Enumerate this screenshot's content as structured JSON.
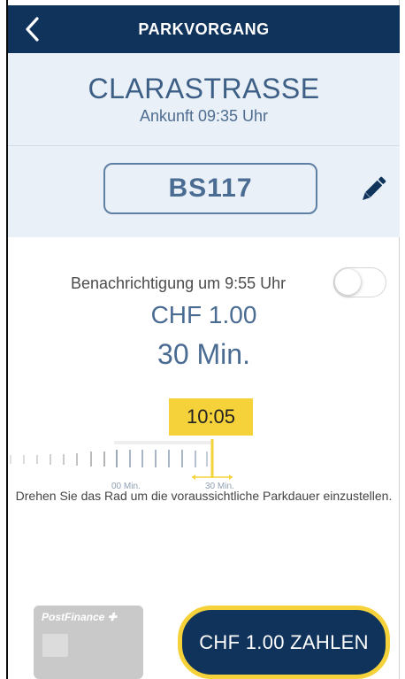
{
  "header": {
    "title": "PARKVORGANG"
  },
  "location": {
    "street": "CLARASTRASSE",
    "arrival": "Ankunft 09:35 Uhr"
  },
  "vehicle": {
    "plate": "BS117"
  },
  "notification": {
    "label": "Benachrichtigung um 9:55 Uhr",
    "enabled": false
  },
  "parking": {
    "price": "CHF 1.00",
    "duration": "30 Min.",
    "end_time": "10:05"
  },
  "wheel": {
    "start_label": "00 Min.",
    "end_label": "30 Min.",
    "hint": "Drehen Sie das Rad um die voraussichtliche Parkdauer einzustellen."
  },
  "payment": {
    "card_brand": "PostFinance",
    "pay_label": "CHF 1.00 ZAHLEN"
  },
  "colors": {
    "navy": "#10335c",
    "accent_yellow": "#f6d23a",
    "panel_bg": "#e9f0f8",
    "text_blue": "#4a6b92"
  }
}
